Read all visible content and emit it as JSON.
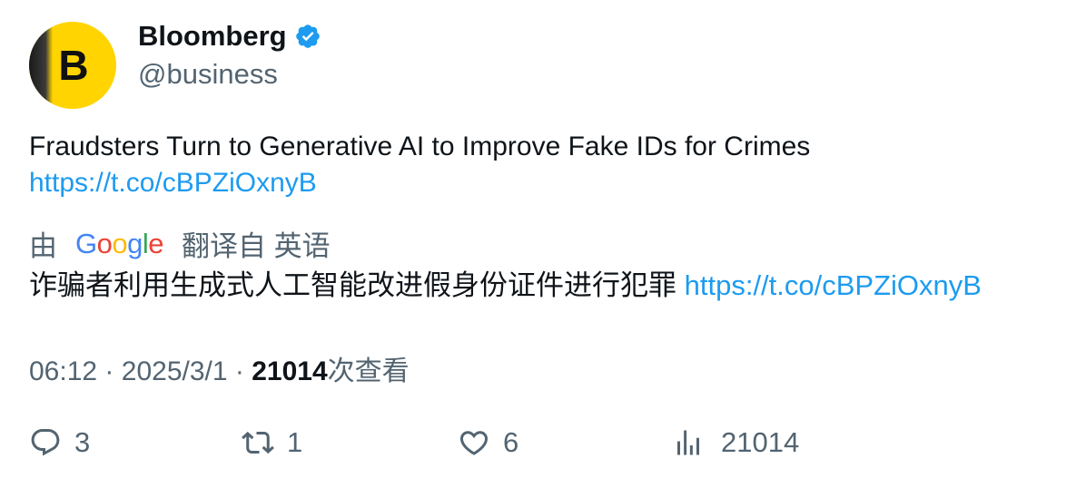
{
  "author": {
    "name": "Bloomberg",
    "handle": "@business",
    "avatar_letter": "B",
    "verified": true,
    "brand_color": "#ffd400"
  },
  "tweet": {
    "text": "Fraudsters Turn to Generative AI to Improve Fake IDs for Crimes",
    "link": "https://t.co/cBPZiOxnyB"
  },
  "translation": {
    "by": "由",
    "provider": "Google",
    "from_language": "翻译自 英语",
    "text": "诈骗者利用生成式人工智能改进假身份证件进行犯罪",
    "link": "https://t.co/cBPZiOxnyB"
  },
  "meta": {
    "time": "06:12",
    "separator": "·",
    "date": "2025/3/1",
    "views": "21014",
    "views_label": "次查看"
  },
  "actions": {
    "replies": "3",
    "retweets": "1",
    "likes": "6",
    "views": "21014"
  },
  "colors": {
    "link": "#1d9bf0",
    "secondary_text": "#536471",
    "primary_text": "#0f1419",
    "verified_badge": "#1d9bf0"
  },
  "icons": [
    "verified-badge-icon",
    "reply-icon",
    "retweet-icon",
    "like-icon",
    "views-icon"
  ]
}
